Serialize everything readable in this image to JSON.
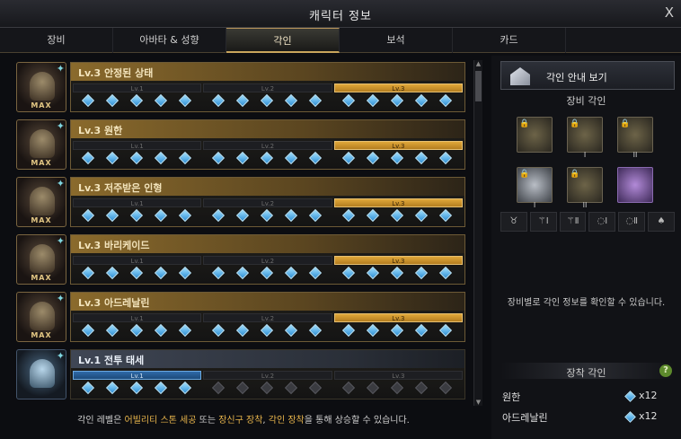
{
  "window": {
    "title": "캐릭터 정보",
    "close": "X"
  },
  "tabs": [
    {
      "label": "장비",
      "active": false
    },
    {
      "label": "아바타 & 성향",
      "active": false
    },
    {
      "label": "각인",
      "active": true
    },
    {
      "label": "보석",
      "active": false
    },
    {
      "label": "카드",
      "active": false
    }
  ],
  "engravings": [
    {
      "name": "Lv.3 안정된 상태",
      "badge": "MAX",
      "level": 3,
      "max": true
    },
    {
      "name": "Lv.3 원한",
      "badge": "MAX",
      "level": 3,
      "max": true
    },
    {
      "name": "Lv.3 저주받은 인형",
      "badge": "MAX",
      "level": 3,
      "max": true
    },
    {
      "name": "Lv.3 바리케이드",
      "badge": "MAX",
      "level": 3,
      "max": true
    },
    {
      "name": "Lv.3 아드레날린",
      "badge": "MAX",
      "level": 3,
      "max": true
    },
    {
      "name": "Lv.1 전투 태세",
      "badge": "",
      "level": 1,
      "max": false
    }
  ],
  "level_labels": [
    "Lv.1",
    "Lv.2",
    "Lv.3"
  ],
  "gems_per_level": 5,
  "footer": {
    "p1": "각인 레벨은 ",
    "h1": "어빌리티 스톤 세공",
    "p2": " 또는 ",
    "h2": "장신구 장착",
    "p3": ", ",
    "h3": "각인 장착",
    "p4": "을 통해 상승할 수 있습니다."
  },
  "right": {
    "guide_button": "각인 안내 보기",
    "equip_engrave_title": "장비 각인",
    "slot_roman": [
      "",
      "I",
      "II",
      "I",
      "II",
      ""
    ],
    "slot_icons": [
      "amulet-slot-icon",
      "earring1-slot-icon",
      "earring2-slot-icon",
      "ring1-slot-icon",
      "ring2-slot-icon",
      "stone-slot-icon"
    ],
    "slot_glyphs": [
      "♉",
      "⚚Ⅰ",
      "⚚Ⅱ",
      "◌Ⅰ",
      "◌Ⅱ",
      "♠"
    ],
    "info_text": "장비별로 각인 정보를 확인할 수 있습니다.",
    "applied_title": "장착 각인",
    "help": "?",
    "applied": [
      {
        "name": "원한",
        "count": "x12"
      },
      {
        "name": "아드레날린",
        "count": "x12"
      }
    ]
  },
  "colors": {
    "gold": "#c9a55d",
    "gem": "#2f8fd6",
    "active_level": "#e0a83a",
    "blue_level": "#2f6aa8"
  }
}
